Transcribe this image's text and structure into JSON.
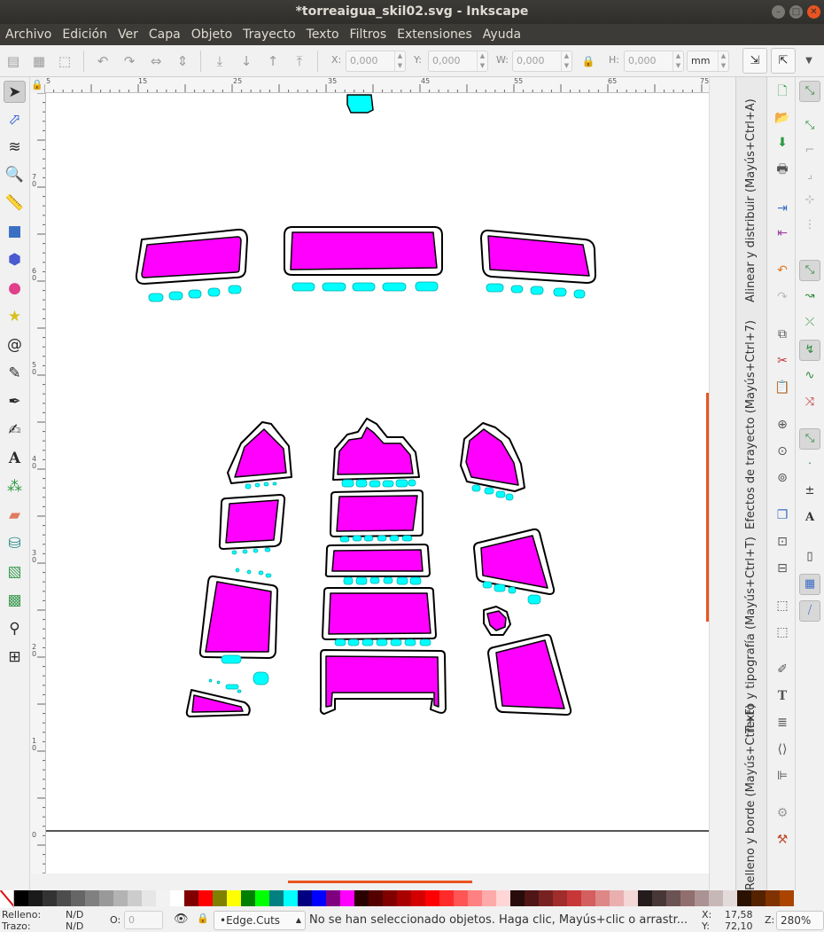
{
  "window": {
    "title": "*torreaigua_skil02.svg - Inkscape"
  },
  "menu": [
    "Archivo",
    "Edición",
    "Ver",
    "Capa",
    "Objeto",
    "Trayecto",
    "Texto",
    "Filtros",
    "Extensiones",
    "Ayuda"
  ],
  "toolbar": {
    "x_label": "X:",
    "x_value": "0,000",
    "y_label": "Y:",
    "y_value": "0,000",
    "w_label": "W:",
    "w_value": "0,000",
    "h_label": "H:",
    "h_value": "0,000",
    "unit": "mm"
  },
  "hruler_labels": [
    "5",
    "15",
    "25",
    "35",
    "45",
    "55",
    "65",
    "75"
  ],
  "vruler_labels": [
    "7\n0",
    "6\n0",
    "5\n0",
    "4\n0",
    "3\n0",
    "2\n0",
    "1\n0",
    "0"
  ],
  "dock_tabs": [
    "Alinear y distribuir (Mayús+Ctrl+A)",
    "Efectos de trayecto (Mayús+Ctrl+7)",
    "Texto y tipografía (Mayús+Ctrl+T)",
    "Relleno y borde (Mayús+Ctrl+F)"
  ],
  "colors": {
    "fill_magenta": "#ff00ff",
    "cut_cyan": "#00ffff",
    "accent": "#e95420"
  },
  "palette": [
    "#000000",
    "#1a1a1a",
    "#333333",
    "#4d4d4d",
    "#666666",
    "#808080",
    "#999999",
    "#b3b3b3",
    "#cccccc",
    "#e6e6e6",
    "#f2f2f2",
    "#ffffff",
    "#800000",
    "#ff0000",
    "#808000",
    "#ffff00",
    "#008000",
    "#00ff00",
    "#008080",
    "#00ffff",
    "#000080",
    "#0000ff",
    "#800080",
    "#ff00ff",
    "#2b0000",
    "#550000",
    "#800000",
    "#aa0000",
    "#d40000",
    "#ff0000",
    "#ff2a2a",
    "#ff5555",
    "#ff8080",
    "#ffaaaa",
    "#ffd5d5",
    "#280b0b",
    "#501616",
    "#782121",
    "#a02c2c",
    "#c83737",
    "#d35f5f",
    "#de8787",
    "#e9afaf",
    "#f4d7d7",
    "#241c1c",
    "#483737",
    "#6c5353",
    "#916f6f",
    "#ac9393",
    "#c8b7b7",
    "#e3dbdb",
    "#2b1100",
    "#552200",
    "#803300",
    "#aa4400"
  ],
  "status": {
    "fill_label": "Relleno:",
    "fill_value": "N/D",
    "stroke_label": "Trazo:",
    "stroke_value": "N/D",
    "opacity_label": "O:",
    "opacity_value": "0",
    "layer": "•Edge.Cuts",
    "message": "No se han seleccionado objetos. Haga clic, Mayús+clic o arrastr...",
    "x_label": "X:",
    "x_coord": "17,58",
    "y_label": "Y:",
    "y_coord": "72,10",
    "zoom_label": "Z:",
    "zoom": "280%"
  }
}
